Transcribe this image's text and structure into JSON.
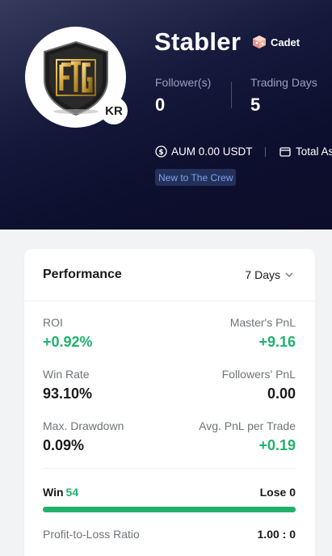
{
  "profile": {
    "name": "Stabler",
    "rank": "Cadet",
    "country": "KR",
    "tag": "New to The Crew"
  },
  "stats": {
    "followers_label": "Follower(s)",
    "followers_value": "0",
    "trading_days_label": "Trading Days",
    "trading_days_value": "5"
  },
  "aum": {
    "icon": "dollar-circle-icon",
    "label": "AUM 0.00 USDT"
  },
  "total": {
    "icon": "wallet-icon",
    "label": "Total As"
  },
  "performance": {
    "title": "Performance",
    "period": "7 Days",
    "metrics": {
      "roi_label": "ROI",
      "roi_value": "+0.92%",
      "master_pnl_label": "Master's PnL",
      "master_pnl_value": "+9.16",
      "win_rate_label": "Win Rate",
      "win_rate_value": "93.10%",
      "followers_pnl_label": "Followers' PnL",
      "followers_pnl_value": "0.00",
      "max_drawdown_label": "Max. Drawdown",
      "max_drawdown_value": "0.09%",
      "avg_pnl_label": "Avg. PnL per Trade",
      "avg_pnl_value": "+0.19"
    },
    "win_label": "Win",
    "win_count": "54",
    "lose_label": "Lose",
    "lose_count": "0",
    "win_share": 1.0,
    "ratio_label": "Profit-to-Loss Ratio",
    "ratio_value": "1.00 : 0"
  },
  "colors": {
    "positive": "#20b26c",
    "negative": "#e34a5f",
    "hero_bg": "#0d0f2e",
    "tag_text": "#7fa2ec"
  }
}
